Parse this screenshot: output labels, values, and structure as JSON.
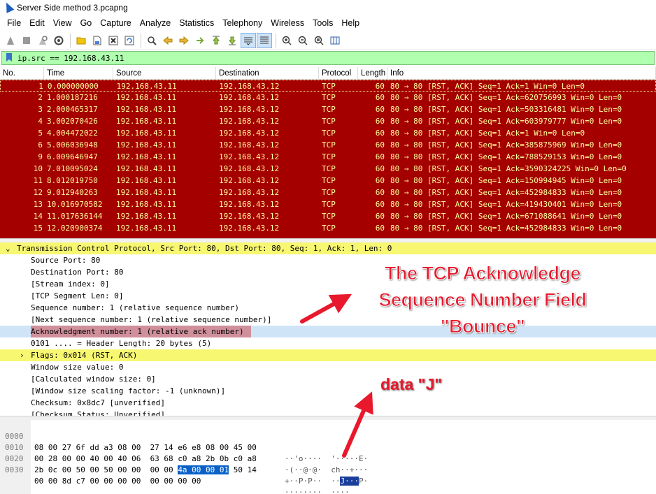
{
  "window": {
    "title": "Server Side method 3.pcapng"
  },
  "menu": [
    "File",
    "Edit",
    "View",
    "Go",
    "Capture",
    "Analyze",
    "Statistics",
    "Telephony",
    "Wireless",
    "Tools",
    "Help"
  ],
  "filter": {
    "value": "ip.src == 192.168.43.11"
  },
  "packet_list": {
    "columns": [
      "No.",
      "Time",
      "Source",
      "Destination",
      "Protocol",
      "Length",
      "Info"
    ],
    "rows": [
      {
        "no": "1",
        "time": "0.000000000",
        "src": "192.168.43.11",
        "dst": "192.168.43.12",
        "proto": "TCP",
        "len": "60",
        "info": "80 → 80 [RST, ACK] Seq=1 Ack=1 Win=0 Len=0"
      },
      {
        "no": "2",
        "time": "1.000187216",
        "src": "192.168.43.11",
        "dst": "192.168.43.12",
        "proto": "TCP",
        "len": "60",
        "info": "80 → 80 [RST, ACK] Seq=1 Ack=620756993 Win=0 Len=0"
      },
      {
        "no": "3",
        "time": "2.000465317",
        "src": "192.168.43.11",
        "dst": "192.168.43.12",
        "proto": "TCP",
        "len": "60",
        "info": "80 → 80 [RST, ACK] Seq=1 Ack=503316481 Win=0 Len=0"
      },
      {
        "no": "4",
        "time": "3.002070426",
        "src": "192.168.43.11",
        "dst": "192.168.43.12",
        "proto": "TCP",
        "len": "60",
        "info": "80 → 80 [RST, ACK] Seq=1 Ack=603979777 Win=0 Len=0"
      },
      {
        "no": "5",
        "time": "4.004472022",
        "src": "192.168.43.11",
        "dst": "192.168.43.12",
        "proto": "TCP",
        "len": "60",
        "info": "80 → 80 [RST, ACK] Seq=1 Ack=1 Win=0 Len=0"
      },
      {
        "no": "6",
        "time": "5.006036948",
        "src": "192.168.43.11",
        "dst": "192.168.43.12",
        "proto": "TCP",
        "len": "60",
        "info": "80 → 80 [RST, ACK] Seq=1 Ack=385875969 Win=0 Len=0"
      },
      {
        "no": "9",
        "time": "6.009646947",
        "src": "192.168.43.11",
        "dst": "192.168.43.12",
        "proto": "TCP",
        "len": "60",
        "info": "80 → 80 [RST, ACK] Seq=1 Ack=788529153 Win=0 Len=0"
      },
      {
        "no": "10",
        "time": "7.010095024",
        "src": "192.168.43.11",
        "dst": "192.168.43.12",
        "proto": "TCP",
        "len": "60",
        "info": "80 → 80 [RST, ACK] Seq=1 Ack=3590324225 Win=0 Len=0"
      },
      {
        "no": "11",
        "time": "8.012019750",
        "src": "192.168.43.11",
        "dst": "192.168.43.12",
        "proto": "TCP",
        "len": "60",
        "info": "80 → 80 [RST, ACK] Seq=1 Ack=150994945 Win=0 Len=0"
      },
      {
        "no": "12",
        "time": "9.012940263",
        "src": "192.168.43.11",
        "dst": "192.168.43.12",
        "proto": "TCP",
        "len": "60",
        "info": "80 → 80 [RST, ACK] Seq=1 Ack=452984833 Win=0 Len=0"
      },
      {
        "no": "13",
        "time": "10.016970582",
        "src": "192.168.43.11",
        "dst": "192.168.43.12",
        "proto": "TCP",
        "len": "60",
        "info": "80 → 80 [RST, ACK] Seq=1 Ack=419430401 Win=0 Len=0"
      },
      {
        "no": "14",
        "time": "11.017636144",
        "src": "192.168.43.11",
        "dst": "192.168.43.12",
        "proto": "TCP",
        "len": "60",
        "info": "80 → 80 [RST, ACK] Seq=1 Ack=671088641 Win=0 Len=0"
      },
      {
        "no": "15",
        "time": "12.020900374",
        "src": "192.168.43.11",
        "dst": "192.168.43.12",
        "proto": "TCP",
        "len": "60",
        "info": "80 → 80 [RST, ACK] Seq=1 Ack=452984833 Win=0 Len=0"
      }
    ]
  },
  "details": {
    "header": "Transmission Control Protocol, Src Port: 80, Dst Port: 80, Seq: 1, Ack: 1, Len: 0",
    "lines": [
      "Source Port: 80",
      "Destination Port: 80",
      "[Stream index: 0]",
      "[TCP Segment Len: 0]",
      "Sequence number: 1    (relative sequence number)",
      "[Next sequence number: 1    (relative sequence number)]",
      "Acknowledgment number: 1    (relative ack number)",
      "0101 .... = Header Length: 20 bytes (5)",
      "Flags: 0x014 (RST, ACK)",
      "Window size value: 0",
      "[Calculated window size: 0]",
      "[Window size scaling factor: -1 (unknown)]",
      "Checksum: 0x8dc7 [unverified]",
      "[Checksum Status: Unverified]"
    ]
  },
  "bytes": {
    "rows": [
      {
        "offset": "0000",
        "hex_a": "08 00 27 6f dd a3 08 00  27 14 e6 e8 08 00 45 00",
        "hex_hl": "",
        "hex_b": "",
        "ascii_a": "··'o····  '·····E·",
        "ascii_hl": "",
        "ascii_b": ""
      },
      {
        "offset": "0010",
        "hex_a": "00 28 00 00 40 00 40 06  63 68 c0 a8 2b 0b c0 a8",
        "hex_hl": "",
        "hex_b": "",
        "ascii_a": "·(··@·@·  ch··+···",
        "ascii_hl": "",
        "ascii_b": ""
      },
      {
        "offset": "0020",
        "hex_a": "2b 0c 00 50 00 50 00 00  00 00 ",
        "hex_hl": "4a 00 00 01",
        "hex_b": " 50 14",
        "ascii_a": "+··P·P··  ··",
        "ascii_hl": "J···",
        "ascii_b": "P·"
      },
      {
        "offset": "0030",
        "hex_a": "00 00 8d c7 00 00 00 00  00 00 00 00",
        "hex_hl": "",
        "hex_b": "",
        "ascii_a": "········  ····",
        "ascii_hl": "",
        "ascii_b": ""
      }
    ]
  },
  "annotations": {
    "main": [
      "The TCP Acknowledge",
      "Sequence Number Field",
      "\"Bounce\""
    ],
    "data": "data \"J\""
  },
  "colors": {
    "packet_bg": "#a40000",
    "packet_fg": "#fffc9c",
    "filter_bg": "#afffaf",
    "header_bg": "#f7f772",
    "annotation": "#e8192d"
  }
}
